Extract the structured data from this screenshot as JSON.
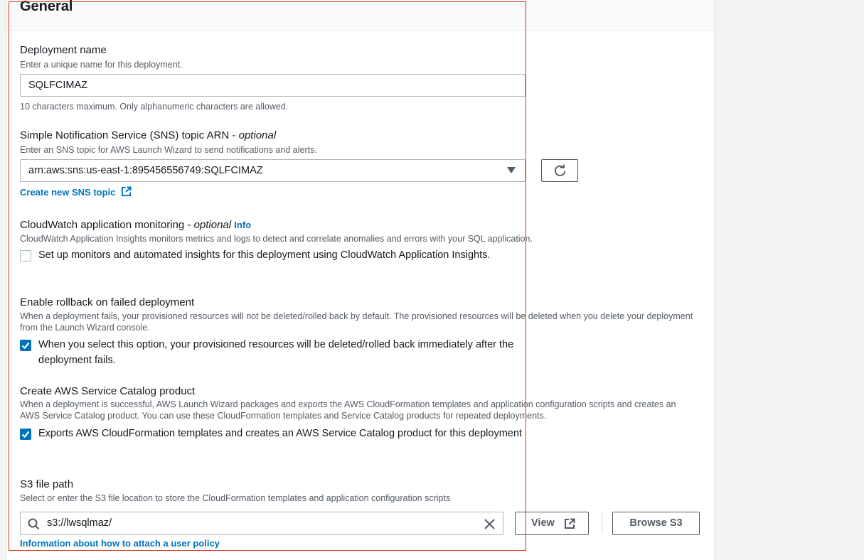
{
  "header": {
    "title": "General"
  },
  "deployment_name": {
    "label": "Deployment name",
    "description": "Enter a unique name for this deployment.",
    "value": "SQLFCIMAZ",
    "hint": "10 characters maximum. Only alphanumeric characters are allowed."
  },
  "sns": {
    "label": "Simple Notification Service (SNS) topic ARN",
    "optional": "optional",
    "description": "Enter an SNS topic for AWS Launch Wizard to send notifications and alerts.",
    "value": "arn:aws:sns:us-east-1:895456556749:SQLFCIMAZ",
    "create_link": "Create new SNS topic"
  },
  "cloudwatch": {
    "label": "CloudWatch application monitoring",
    "optional": "optional",
    "info": "Info",
    "description": "CloudWatch Application Insights monitors metrics and logs to detect and correlate anomalies and errors with your SQL application.",
    "checkbox_text": "Set up monitors and automated insights for this deployment using CloudWatch Application Insights.",
    "checked": false
  },
  "rollback": {
    "label": "Enable rollback on failed deployment",
    "description": "When a deployment fails, your provisioned resources will not be deleted/rolled back by default. The provisioned resources will be deleted when you delete your deployment from the Launch Wizard console.",
    "checkbox_text": "When you select this option, your provisioned resources will be deleted/rolled back immediately after the deployment fails.",
    "checked": true
  },
  "catalog": {
    "label": "Create AWS Service Catalog product",
    "description": "When a deployment is successful, AWS Launch Wizard packages and exports the AWS CloudFormation templates and application configuration scripts and creates an AWS Service Catalog product. You can use these CloudFormation templates and Service Catalog products for repeated deployments.",
    "checkbox_text": "Exports AWS CloudFormation templates and creates an AWS Service Catalog product for this deployment",
    "checked": true
  },
  "s3": {
    "label": "S3 file path",
    "description": "Select or enter the S3 file location to store the CloudFormation templates and application configuration scripts",
    "value": "s3://lwsqlmaz/",
    "view_label": "View",
    "browse_label": "Browse S3",
    "info_link": "Information about how to attach a user policy"
  },
  "colors": {
    "accent": "#0073bb",
    "frame": "#d13212"
  }
}
